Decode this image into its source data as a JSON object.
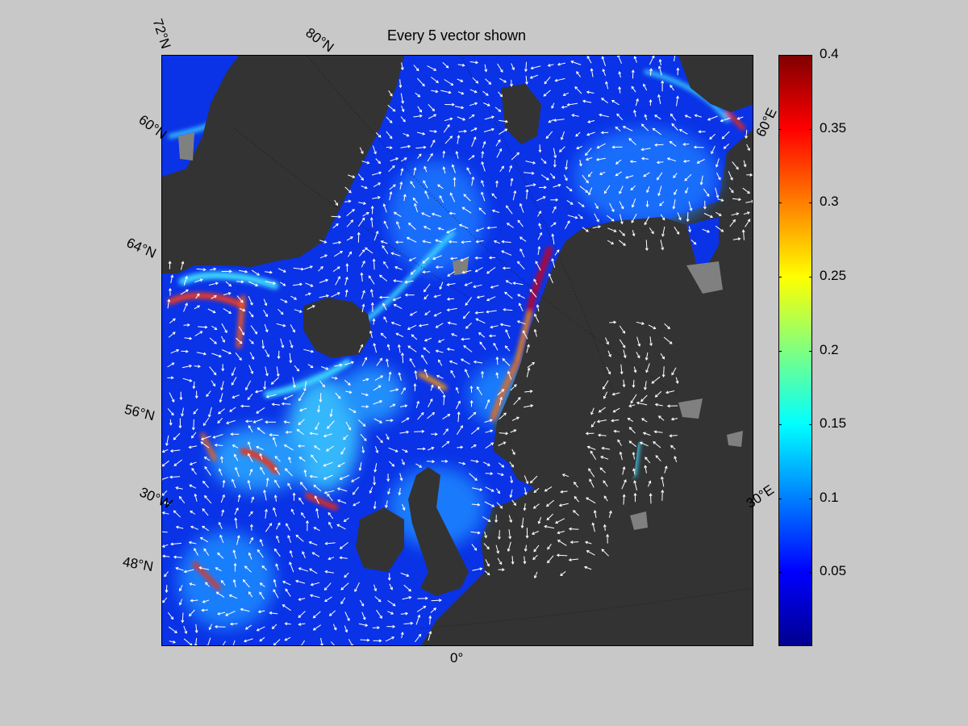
{
  "title": "Every 5 vector shown",
  "map": {
    "land_color": "#333333",
    "sea_ice_color": "#808080",
    "vector_color": "#ffffff",
    "colormap": "jet",
    "axis_labels": [
      {
        "id": "lat-72",
        "text": "72°N"
      },
      {
        "id": "lat-80",
        "text": "80°N"
      },
      {
        "id": "lat-60",
        "text": "60°N"
      },
      {
        "id": "lat-64",
        "text": "64°N"
      },
      {
        "id": "lat-56",
        "text": "56°N"
      },
      {
        "id": "lon-30w",
        "text": "30°W"
      },
      {
        "id": "lat-48",
        "text": "48°N"
      },
      {
        "id": "lon-0",
        "text": "0°"
      },
      {
        "id": "lon-60e",
        "text": "60°E"
      },
      {
        "id": "lon-30e",
        "text": "30°E"
      }
    ]
  },
  "colorbar": {
    "min": 0,
    "max": 0.4,
    "ticks": [
      "0.4",
      "0.35",
      "0.3",
      "0.25",
      "0.2",
      "0.15",
      "0.1",
      "0.05"
    ],
    "tick_values": [
      0.4,
      0.35,
      0.3,
      0.25,
      0.2,
      0.15,
      0.1,
      0.05
    ]
  }
}
